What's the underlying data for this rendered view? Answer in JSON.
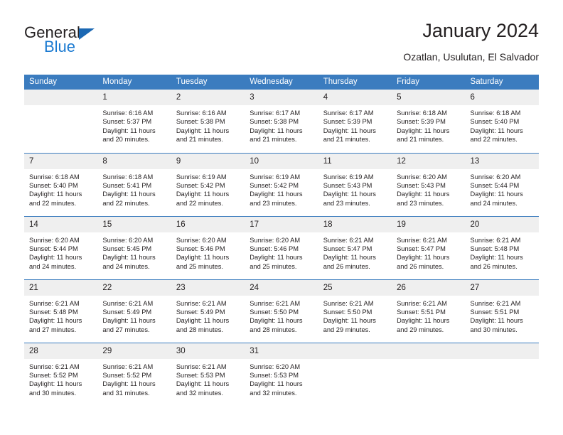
{
  "brand": {
    "name_part1": "General",
    "name_part2": "Blue",
    "triangle_color": "#1b68b3",
    "blue_color": "#1b7ad1"
  },
  "header": {
    "title": "January 2024",
    "subtitle": "Ozatlan, Usulutan, El Salvador",
    "header_bg": "#3b7cbf",
    "daynum_bg": "#efefef"
  },
  "weekdays": [
    "Sunday",
    "Monday",
    "Tuesday",
    "Wednesday",
    "Thursday",
    "Friday",
    "Saturday"
  ],
  "weeks": [
    [
      {
        "day": "",
        "l1": "",
        "l2": "",
        "l3": "",
        "l4": ""
      },
      {
        "day": "1",
        "l1": "Sunrise: 6:16 AM",
        "l2": "Sunset: 5:37 PM",
        "l3": "Daylight: 11 hours",
        "l4": "and 20 minutes."
      },
      {
        "day": "2",
        "l1": "Sunrise: 6:16 AM",
        "l2": "Sunset: 5:38 PM",
        "l3": "Daylight: 11 hours",
        "l4": "and 21 minutes."
      },
      {
        "day": "3",
        "l1": "Sunrise: 6:17 AM",
        "l2": "Sunset: 5:38 PM",
        "l3": "Daylight: 11 hours",
        "l4": "and 21 minutes."
      },
      {
        "day": "4",
        "l1": "Sunrise: 6:17 AM",
        "l2": "Sunset: 5:39 PM",
        "l3": "Daylight: 11 hours",
        "l4": "and 21 minutes."
      },
      {
        "day": "5",
        "l1": "Sunrise: 6:18 AM",
        "l2": "Sunset: 5:39 PM",
        "l3": "Daylight: 11 hours",
        "l4": "and 21 minutes."
      },
      {
        "day": "6",
        "l1": "Sunrise: 6:18 AM",
        "l2": "Sunset: 5:40 PM",
        "l3": "Daylight: 11 hours",
        "l4": "and 22 minutes."
      }
    ],
    [
      {
        "day": "7",
        "l1": "Sunrise: 6:18 AM",
        "l2": "Sunset: 5:40 PM",
        "l3": "Daylight: 11 hours",
        "l4": "and 22 minutes."
      },
      {
        "day": "8",
        "l1": "Sunrise: 6:18 AM",
        "l2": "Sunset: 5:41 PM",
        "l3": "Daylight: 11 hours",
        "l4": "and 22 minutes."
      },
      {
        "day": "9",
        "l1": "Sunrise: 6:19 AM",
        "l2": "Sunset: 5:42 PM",
        "l3": "Daylight: 11 hours",
        "l4": "and 22 minutes."
      },
      {
        "day": "10",
        "l1": "Sunrise: 6:19 AM",
        "l2": "Sunset: 5:42 PM",
        "l3": "Daylight: 11 hours",
        "l4": "and 23 minutes."
      },
      {
        "day": "11",
        "l1": "Sunrise: 6:19 AM",
        "l2": "Sunset: 5:43 PM",
        "l3": "Daylight: 11 hours",
        "l4": "and 23 minutes."
      },
      {
        "day": "12",
        "l1": "Sunrise: 6:20 AM",
        "l2": "Sunset: 5:43 PM",
        "l3": "Daylight: 11 hours",
        "l4": "and 23 minutes."
      },
      {
        "day": "13",
        "l1": "Sunrise: 6:20 AM",
        "l2": "Sunset: 5:44 PM",
        "l3": "Daylight: 11 hours",
        "l4": "and 24 minutes."
      }
    ],
    [
      {
        "day": "14",
        "l1": "Sunrise: 6:20 AM",
        "l2": "Sunset: 5:44 PM",
        "l3": "Daylight: 11 hours",
        "l4": "and 24 minutes."
      },
      {
        "day": "15",
        "l1": "Sunrise: 6:20 AM",
        "l2": "Sunset: 5:45 PM",
        "l3": "Daylight: 11 hours",
        "l4": "and 24 minutes."
      },
      {
        "day": "16",
        "l1": "Sunrise: 6:20 AM",
        "l2": "Sunset: 5:46 PM",
        "l3": "Daylight: 11 hours",
        "l4": "and 25 minutes."
      },
      {
        "day": "17",
        "l1": "Sunrise: 6:20 AM",
        "l2": "Sunset: 5:46 PM",
        "l3": "Daylight: 11 hours",
        "l4": "and 25 minutes."
      },
      {
        "day": "18",
        "l1": "Sunrise: 6:21 AM",
        "l2": "Sunset: 5:47 PM",
        "l3": "Daylight: 11 hours",
        "l4": "and 26 minutes."
      },
      {
        "day": "19",
        "l1": "Sunrise: 6:21 AM",
        "l2": "Sunset: 5:47 PM",
        "l3": "Daylight: 11 hours",
        "l4": "and 26 minutes."
      },
      {
        "day": "20",
        "l1": "Sunrise: 6:21 AM",
        "l2": "Sunset: 5:48 PM",
        "l3": "Daylight: 11 hours",
        "l4": "and 26 minutes."
      }
    ],
    [
      {
        "day": "21",
        "l1": "Sunrise: 6:21 AM",
        "l2": "Sunset: 5:48 PM",
        "l3": "Daylight: 11 hours",
        "l4": "and 27 minutes."
      },
      {
        "day": "22",
        "l1": "Sunrise: 6:21 AM",
        "l2": "Sunset: 5:49 PM",
        "l3": "Daylight: 11 hours",
        "l4": "and 27 minutes."
      },
      {
        "day": "23",
        "l1": "Sunrise: 6:21 AM",
        "l2": "Sunset: 5:49 PM",
        "l3": "Daylight: 11 hours",
        "l4": "and 28 minutes."
      },
      {
        "day": "24",
        "l1": "Sunrise: 6:21 AM",
        "l2": "Sunset: 5:50 PM",
        "l3": "Daylight: 11 hours",
        "l4": "and 28 minutes."
      },
      {
        "day": "25",
        "l1": "Sunrise: 6:21 AM",
        "l2": "Sunset: 5:50 PM",
        "l3": "Daylight: 11 hours",
        "l4": "and 29 minutes."
      },
      {
        "day": "26",
        "l1": "Sunrise: 6:21 AM",
        "l2": "Sunset: 5:51 PM",
        "l3": "Daylight: 11 hours",
        "l4": "and 29 minutes."
      },
      {
        "day": "27",
        "l1": "Sunrise: 6:21 AM",
        "l2": "Sunset: 5:51 PM",
        "l3": "Daylight: 11 hours",
        "l4": "and 30 minutes."
      }
    ],
    [
      {
        "day": "28",
        "l1": "Sunrise: 6:21 AM",
        "l2": "Sunset: 5:52 PM",
        "l3": "Daylight: 11 hours",
        "l4": "and 30 minutes."
      },
      {
        "day": "29",
        "l1": "Sunrise: 6:21 AM",
        "l2": "Sunset: 5:52 PM",
        "l3": "Daylight: 11 hours",
        "l4": "and 31 minutes."
      },
      {
        "day": "30",
        "l1": "Sunrise: 6:21 AM",
        "l2": "Sunset: 5:53 PM",
        "l3": "Daylight: 11 hours",
        "l4": "and 32 minutes."
      },
      {
        "day": "31",
        "l1": "Sunrise: 6:20 AM",
        "l2": "Sunset: 5:53 PM",
        "l3": "Daylight: 11 hours",
        "l4": "and 32 minutes."
      },
      {
        "day": "",
        "l1": "",
        "l2": "",
        "l3": "",
        "l4": ""
      },
      {
        "day": "",
        "l1": "",
        "l2": "",
        "l3": "",
        "l4": ""
      },
      {
        "day": "",
        "l1": "",
        "l2": "",
        "l3": "",
        "l4": ""
      }
    ]
  ]
}
